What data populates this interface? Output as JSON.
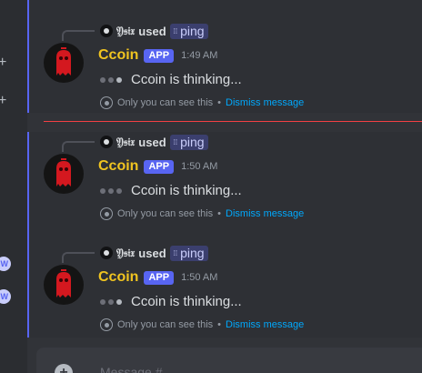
{
  "sidebar": {
    "plus_icons": [
      "+",
      "+"
    ],
    "pills": [
      "W",
      "W"
    ]
  },
  "messages": [
    {
      "reply_user": "𝔜𝔰𝔦𝔵",
      "reply_used": "used",
      "command": "ping",
      "bot_name": "Ccoin",
      "app_tag": "APP",
      "time": "1:49 AM",
      "thinking": "Ccoin is thinking...",
      "only_you": "Only you can see this",
      "separator": "•",
      "dismiss": "Dismiss message"
    },
    {
      "reply_user": "𝔜𝔰𝔦𝔵",
      "reply_used": "used",
      "command": "ping",
      "bot_name": "Ccoin",
      "app_tag": "APP",
      "time": "1:50 AM",
      "thinking": "Ccoin is thinking...",
      "only_you": "Only you can see this",
      "separator": "•",
      "dismiss": "Dismiss message"
    },
    {
      "reply_user": "𝔜𝔰𝔦𝔵",
      "reply_used": "used",
      "command": "ping",
      "bot_name": "Ccoin",
      "app_tag": "APP",
      "time": "1:50 AM",
      "thinking": "Ccoin is thinking...",
      "only_you": "Only you can see this",
      "separator": "•",
      "dismiss": "Dismiss message"
    }
  ],
  "composer": {
    "add_icon": "+",
    "placeholder": "Message #..."
  },
  "colors": {
    "accent": "#5865f2",
    "bot_name": "#f0c420",
    "link": "#00a8fc",
    "new_divider": "#f23f43"
  },
  "icons": {
    "avatar": "red-ghost-avatar",
    "command": "slash-command-icon",
    "notice": "eye-icon"
  }
}
